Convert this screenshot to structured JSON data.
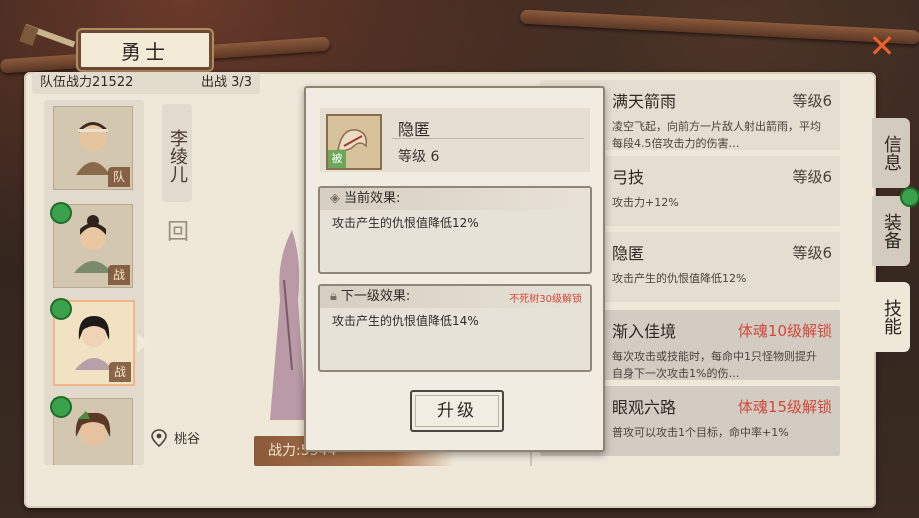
{
  "header": {
    "title": "勇士"
  },
  "team": {
    "power_label": "队伍战力",
    "power_value": "21522",
    "deploy_label": "出战 3/3"
  },
  "roster": [
    {
      "badge": "队",
      "has_dot": false
    },
    {
      "badge": "战",
      "has_dot": true
    },
    {
      "badge": "战",
      "has_dot": true,
      "selected": true
    },
    {
      "badge": "",
      "has_dot": true
    }
  ],
  "hero": {
    "name": "李绫儿",
    "location": "桃谷",
    "power_text": "战力:5544"
  },
  "popup": {
    "skill_name": "隐匿",
    "level_text": "等级 6",
    "icon_tag": "被",
    "current_effect_label": "当前效果:",
    "current_effect_text": "攻击产生的仇恨值降低12%",
    "next_effect_label": "下一级效果:",
    "next_requirement": "不死树30级解锁",
    "next_effect_text": "攻击产生的仇恨值降低14%",
    "upgrade_label": "升级"
  },
  "skills": [
    {
      "name": "满天箭雨",
      "level": "等级6",
      "desc": "凌空飞起，向前方一片敌人射出箭雨，平均每段4.5倍攻击力的伤害…",
      "locked": false
    },
    {
      "name": "弓技",
      "level": "等级6",
      "desc": "攻击力+12%",
      "locked": false
    },
    {
      "name": "隐匿",
      "level": "等级6",
      "desc": "攻击产生的仇恨值降低12%",
      "locked": false
    },
    {
      "name": "渐入佳境",
      "lock_text": "体魂10级解锁",
      "desc": "每次攻击或技能时，每命中1只怪物则提升自身下一次攻击1%的伤…",
      "locked": true
    },
    {
      "name": "眼观六路",
      "lock_text": "体魂15级解锁",
      "desc": "普攻可以攻击1个目标，命中率+1%",
      "locked": true
    }
  ],
  "tabs": [
    {
      "label": "信息",
      "active": false
    },
    {
      "label": "装备",
      "active": false
    },
    {
      "label": "技能",
      "active": true
    }
  ],
  "colors": {
    "accent_close": "#e9622a",
    "locked_text": "#d2493a",
    "ready_dot": "#3aa24a"
  }
}
